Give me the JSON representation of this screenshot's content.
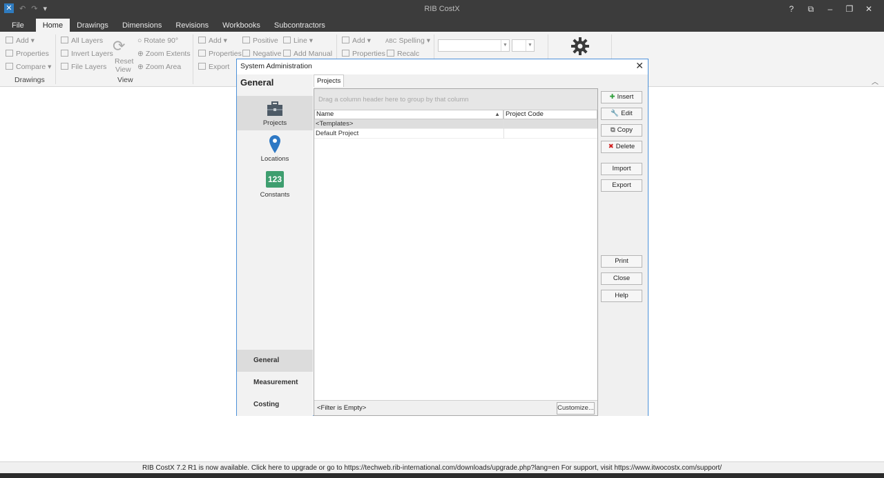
{
  "app": {
    "title": "RIB CostX",
    "window_controls": [
      "?",
      "⧉",
      "–",
      "❐",
      "✕"
    ]
  },
  "ribbon_tabs": [
    {
      "label": "File",
      "active": false
    },
    {
      "label": "Home",
      "active": true
    },
    {
      "label": "Drawings",
      "active": false
    },
    {
      "label": "Dimensions",
      "active": false
    },
    {
      "label": "Revisions",
      "active": false
    },
    {
      "label": "Workbooks",
      "active": false
    },
    {
      "label": "Subcontractors",
      "active": false
    }
  ],
  "ribbon": {
    "drawings_group": {
      "label": "Drawings",
      "items": [
        "Add",
        "Properties",
        "Compare"
      ]
    },
    "view_group": {
      "label": "View",
      "items": [
        "All Layers",
        "Invert Layers",
        "File Layers",
        "Reset",
        "View",
        "Rotate 90°",
        "Zoom Extents",
        "Zoom Area"
      ]
    },
    "dimensions_group": {
      "items": [
        "Add",
        "Properties",
        "Export",
        "Positive",
        "Negative",
        "Line",
        "Add Manual"
      ]
    },
    "workbook_group": {
      "items": [
        "Add",
        "Properties",
        "Spelling",
        "Recalc"
      ]
    }
  },
  "dialog": {
    "title": "System Administration",
    "nav_header": "General",
    "nav_items": [
      {
        "label": "Projects",
        "icon": "briefcase-icon",
        "selected": true
      },
      {
        "label": "Locations",
        "icon": "map-pin-icon",
        "selected": false
      },
      {
        "label": "Constants",
        "icon": "constants-123-icon",
        "icon_text": "123",
        "selected": false
      }
    ],
    "nav_sections": [
      {
        "label": "General",
        "selected": true
      },
      {
        "label": "Measurement",
        "selected": false
      },
      {
        "label": "Costing",
        "selected": false
      }
    ],
    "tab": "Projects",
    "group_hint": "Drag a column header here to group by that column",
    "columns": [
      "Name",
      "Project Code"
    ],
    "rows": [
      {
        "name": "<Templates>",
        "code": "",
        "selected": true
      },
      {
        "name": "Default Project",
        "code": "",
        "selected": false
      }
    ],
    "filter_text": "<Filter is Empty>",
    "customize_label": "Customize...",
    "buttons": {
      "insert": "Insert",
      "edit": "Edit",
      "copy": "Copy",
      "delete": "Delete",
      "import": "Import",
      "export": "Export",
      "print": "Print",
      "close": "Close",
      "help": "Help"
    }
  },
  "status": {
    "message": "RIB CostX 7.2 R1 is now available. Click here to upgrade or go to https://techweb.rib-international.com/downloads/upgrade.php?lang=en For support, visit https://www.itwocostx.com/support/"
  }
}
